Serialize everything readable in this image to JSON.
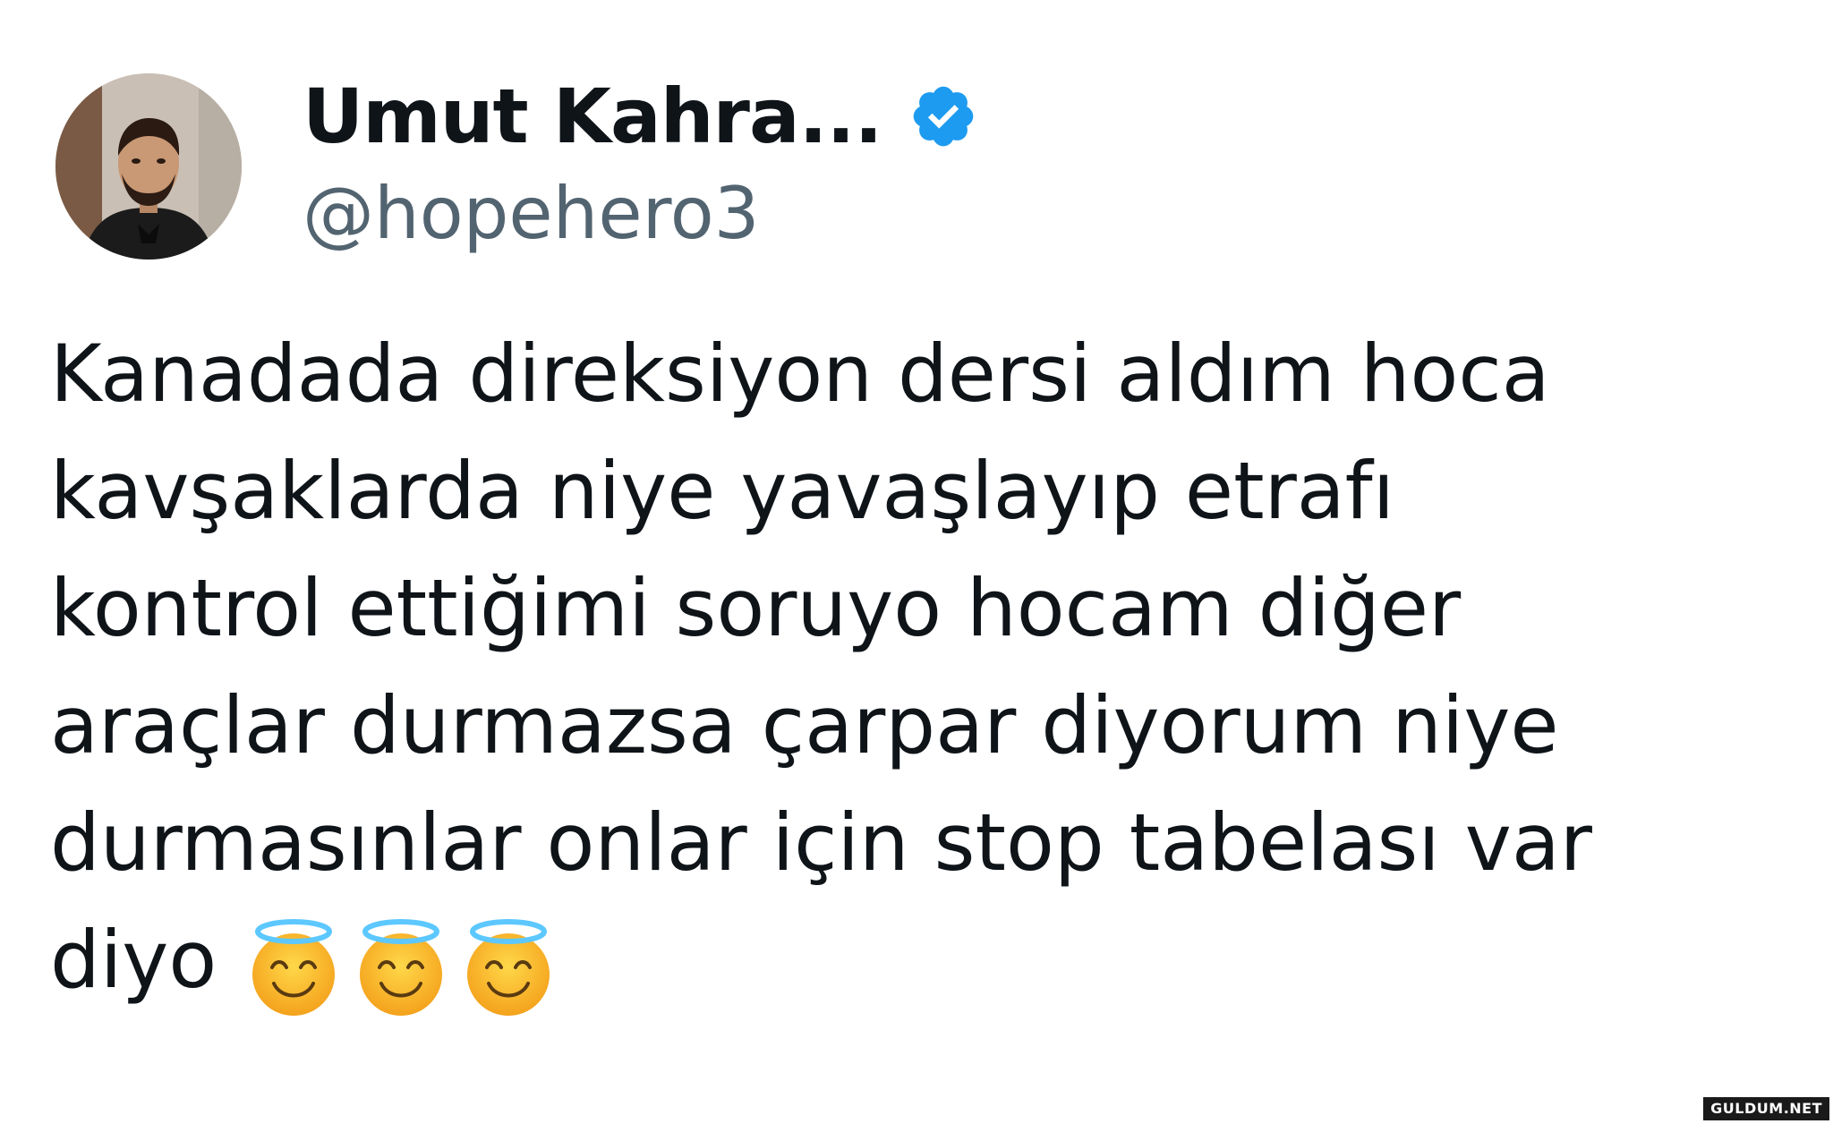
{
  "author": {
    "display_name": "Umut Kahra...",
    "handle": "@hopehero3",
    "verified": true,
    "avatar_icon": "profile-photo",
    "verified_badge_color": "#1d9bf0"
  },
  "tweet": {
    "lines": [
      "Kanadada direksiyon dersi aldım hoca",
      "kavşaklarda niye yavaşlayıp etrafı",
      "kontrol ettiğimi soruyo hocam diğer",
      "araçlar durmazsa çarpar diyorum niye",
      "durmasınlar onlar için stop tabelası var",
      "diyo"
    ],
    "emojis": [
      "smiling-face-with-halo",
      "smiling-face-with-halo",
      "smiling-face-with-halo"
    ]
  },
  "watermark": {
    "text": "GULDUM.NET"
  },
  "colors": {
    "text_primary": "#0f1419",
    "text_secondary": "#536471",
    "background": "#ffffff"
  }
}
